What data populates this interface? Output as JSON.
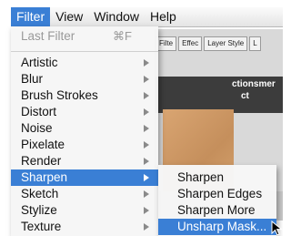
{
  "menubar": {
    "items": [
      {
        "label": "Filter",
        "active": true
      },
      {
        "label": "View",
        "active": false
      },
      {
        "label": "Window",
        "active": false
      },
      {
        "label": "Help",
        "active": false
      }
    ]
  },
  "background_window": {
    "tabs": [
      "Filte",
      "Effec",
      "Layer Style",
      "L"
    ],
    "dark_panel_text": [
      "ctionsmer",
      "ct"
    ]
  },
  "filter_menu": {
    "last_filter": {
      "label": "Last Filter",
      "shortcut": "⌘F",
      "enabled": false
    },
    "items": [
      {
        "label": "Artistic"
      },
      {
        "label": "Blur"
      },
      {
        "label": "Brush Strokes"
      },
      {
        "label": "Distort"
      },
      {
        "label": "Noise"
      },
      {
        "label": "Pixelate"
      },
      {
        "label": "Render"
      },
      {
        "label": "Sharpen",
        "highlighted": true
      },
      {
        "label": "Sketch"
      },
      {
        "label": "Stylize"
      },
      {
        "label": "Texture"
      }
    ]
  },
  "sharpen_submenu": {
    "items": [
      {
        "label": "Sharpen"
      },
      {
        "label": "Sharpen Edges"
      },
      {
        "label": "Sharpen More"
      },
      {
        "label": "Unsharp Mask...",
        "highlighted": true
      }
    ]
  },
  "colors": {
    "highlight": "#3a7fd5",
    "menu_bg": "#f6f6f6",
    "disabled_text": "#9a9a9a"
  }
}
